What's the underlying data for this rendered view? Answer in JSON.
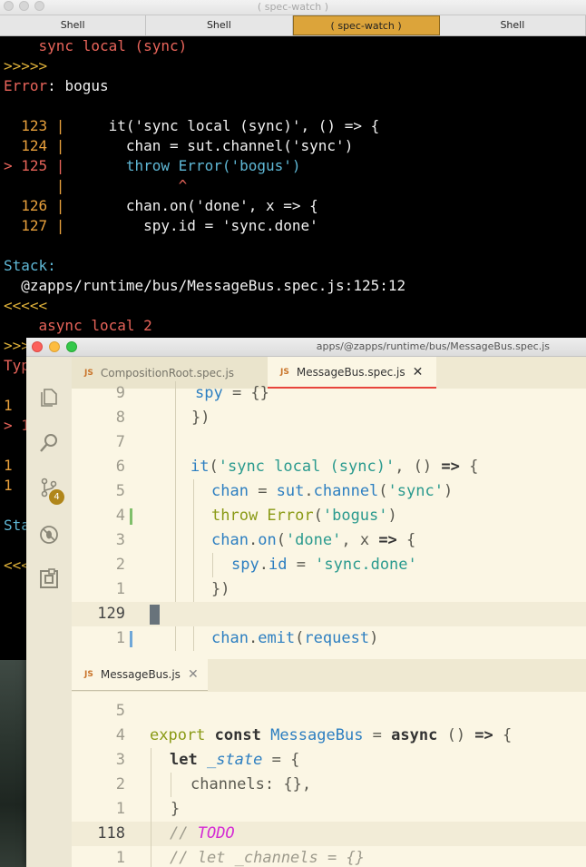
{
  "terminal": {
    "window_title": "( spec-watch )",
    "tabs": [
      {
        "label": "Shell",
        "active": false
      },
      {
        "label": "Shell",
        "active": false
      },
      {
        "label": "( spec-watch )",
        "active": true
      },
      {
        "label": "Shell",
        "active": false
      }
    ],
    "lines": {
      "l1": "    sync local (sync)",
      "l2": ">>>>>",
      "l3_a": "Error",
      "l3_b": ": bogus",
      "c123_n": "  123 |",
      "c123_t": "     it('sync local (sync)', () => {",
      "c124_n": "  124 |",
      "c124_t": "       chan = sut.channel('sync')",
      "c125_n": "> 125 |",
      "c125_t": "       throw Error('bogus')",
      "caret_n": "      |",
      "caret_t": "             ^",
      "c126_n": "  126 |",
      "c126_t": "       chan.on('done', x => {",
      "c127_n": "  127 |",
      "c127_t": "         spy.id = 'sync.done'",
      "stack_label": "Stack:",
      "stack_path": "  @zapps/runtime/bus/MessageBus.spec.js:125:12",
      "l_end": "<<<<<",
      "l_next": "    async local 2",
      "l_next2": ">>>>",
      "frag_typ": "Typ",
      "frag_1a": "1",
      "frag_gt": "> 1",
      "frag_1b": "1",
      "frag_1c": "1",
      "frag_sta": "Sta",
      "frag_lt": "<<<<"
    }
  },
  "editor": {
    "window_title": "apps/@zapps/runtime/bus/MessageBus.spec.js",
    "scm_badge": "4",
    "top_tabs": [
      {
        "lang": "JS",
        "label": "CompositionRoot.spec.js",
        "active": false
      },
      {
        "lang": "JS",
        "label": "MessageBus.spec.js",
        "active": true,
        "close": "✕"
      }
    ],
    "top_lines": [
      {
        "num": "9",
        "text": "  spy = {}"
      },
      {
        "num": "8",
        "text": "})"
      },
      {
        "num": "7",
        "text": ""
      },
      {
        "num": "6",
        "text": "it('sync local (sync)', () => {"
      },
      {
        "num": "5",
        "text": "  chan = sut.channel('sync')"
      },
      {
        "num": "4",
        "text": "  throw Error('bogus')"
      },
      {
        "num": "3",
        "text": "  chan.on('done', x => {"
      },
      {
        "num": "2",
        "text": "    spy.id = 'sync.done'"
      },
      {
        "num": "1",
        "text": "  })"
      },
      {
        "num": "129",
        "text": ""
      },
      {
        "num": "1",
        "text": "  chan.emit(request)"
      }
    ],
    "bottom_tab": {
      "lang": "JS",
      "label": "MessageBus.js",
      "close": "✕"
    },
    "bottom_lines": [
      {
        "num": "5",
        "text": ""
      },
      {
        "num": "4",
        "text": "export const MessageBus = async () => {"
      },
      {
        "num": "3",
        "text": "  let _state = {"
      },
      {
        "num": "2",
        "text": "    channels: {},"
      },
      {
        "num": "1",
        "text": "  }"
      },
      {
        "num": "118",
        "text": "  // TODO"
      },
      {
        "num": "1",
        "text": "  // let _channels = {}"
      }
    ],
    "tokens": {
      "spy": "spy",
      "eq_brace": " = {}",
      "close_paren": "})",
      "it": "it",
      "str_sync_local": "'sync local (sync)'",
      "comma_arrow_pre": ", () ",
      "arrow": "=>",
      "brace_open": " {",
      "chan": "chan",
      "eq": " = ",
      "sut": "sut",
      "dot": ".",
      "channel": "channel",
      "p_open": "(",
      "str_sync": "'sync'",
      "p_close": ")",
      "throw": "throw",
      "error": " Error",
      "str_bogus": "'bogus'",
      "on": "on",
      "str_done": "'done'",
      "comma_x": ", x ",
      "id": "id",
      "str_sync_done": "'sync.done'",
      "emit": "emit",
      "request": "request",
      "export": "export",
      "const": " const ",
      "messagebus": "MessageBus",
      "async": "async",
      "paren_pair": " () ",
      "let": "let",
      "state": "_state",
      "channels": "channels: {},",
      "close_brace": "}",
      "cm_slash": "// ",
      "todo": "TODO",
      "cm_let": "// let _channels = {}"
    }
  }
}
